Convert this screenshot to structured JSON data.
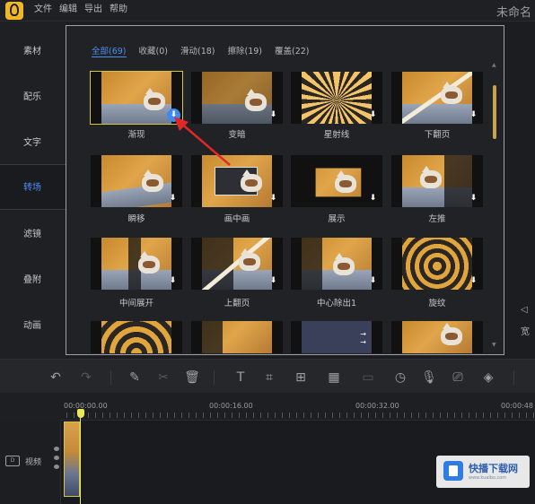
{
  "menu": [
    "文件",
    "编辑",
    "导出",
    "帮助"
  ],
  "app_title": "未命名",
  "sidebar": {
    "items": [
      {
        "label": "素材",
        "active": false
      },
      {
        "label": "配乐",
        "active": false
      },
      {
        "label": "文字",
        "active": false
      },
      {
        "label": "转场",
        "active": true
      },
      {
        "label": "滤镜",
        "active": false
      },
      {
        "label": "叠附",
        "active": false
      },
      {
        "label": "动画",
        "active": false
      }
    ]
  },
  "tabs": [
    {
      "label": "全部(69)",
      "active": true
    },
    {
      "label": "收藏(0)",
      "active": false
    },
    {
      "label": "滑动(18)",
      "active": false
    },
    {
      "label": "擦除(19)",
      "active": false
    },
    {
      "label": "覆盖(22)",
      "active": false
    }
  ],
  "transitions": [
    {
      "label": "渐现",
      "selected": true,
      "downloaded_indicator": "blue"
    },
    {
      "label": "变暗"
    },
    {
      "label": "星射线"
    },
    {
      "label": "下翻页"
    },
    {
      "label": "瞬移"
    },
    {
      "label": "画中画"
    },
    {
      "label": "展示"
    },
    {
      "label": "左推"
    },
    {
      "label": "中间展开"
    },
    {
      "label": "上翻页"
    },
    {
      "label": "中心除出1"
    },
    {
      "label": "旋纹"
    },
    {
      "label": ""
    },
    {
      "label": ""
    },
    {
      "label": ""
    },
    {
      "label": ""
    }
  ],
  "right_edge_label": "宽",
  "toolbar": {
    "icons": [
      "undo-icon",
      "redo-icon",
      "pen-icon",
      "scissors-icon",
      "delete-icon",
      "text-icon",
      "crop-icon",
      "add-frame-icon",
      "mosaic-icon",
      "subtitle-icon",
      "speed-icon",
      "mic-icon",
      "screen-record-icon",
      "fill-icon"
    ]
  },
  "timeline": {
    "timecodes": [
      "00:00:00.00",
      "00:00:16.00",
      "00:00:32.00",
      "00:00:48"
    ],
    "track_label": "视频",
    "track_icon_text": "D"
  },
  "watermark": {
    "title": "快播下载网",
    "subtitle": "www.kuaibo.com"
  },
  "colors": {
    "accent": "#4d8ef0",
    "selection": "#d9c442",
    "annotation_arrow": "#e02828",
    "playhead": "#e8e85a"
  }
}
